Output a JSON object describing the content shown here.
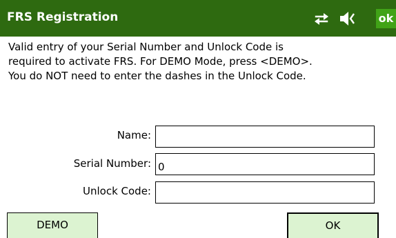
{
  "titlebar": {
    "title": "FRS Registration",
    "ok_label": "ok",
    "icons": [
      "connectivity-arrows-icon",
      "speaker-icon"
    ],
    "background_color": "#2e6a10",
    "ok_color": "#41a317"
  },
  "instructions": {
    "line1": "Valid entry of your Serial Number and Unlock Code is",
    "line2": "required to activate FRS. For DEMO Mode, press <DEMO>.",
    "line3": "You do NOT need to enter the dashes in the Unlock Code."
  },
  "form": {
    "name_label": "Name:",
    "name_value": "",
    "serial_label": "Serial Number:",
    "serial_value": "0",
    "unlock_label": "Unlock Code:",
    "unlock_value": ""
  },
  "buttons": {
    "demo_label": "DEMO",
    "ok_label": "OK",
    "button_color": "#dcf3d1"
  }
}
